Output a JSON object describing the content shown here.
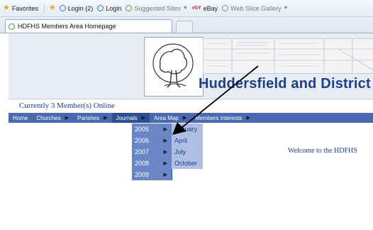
{
  "favorites_bar": {
    "favorites_label": "Favorites",
    "items": [
      {
        "label": "Login (2)",
        "icon": "ie-icon"
      },
      {
        "label": "Login",
        "icon": "ie-icon"
      },
      {
        "label": "Suggested Sites",
        "icon": "suggested-sites-icon"
      },
      {
        "label": "eBay",
        "icon": "ebay-icon"
      },
      {
        "label": "Web Slice Gallery",
        "icon": "ie-icon"
      }
    ]
  },
  "tab": {
    "title": "HDFHS Members Area Homepage"
  },
  "header": {
    "site_title": "Huddersfield and District F"
  },
  "online_status": "Currently 3 Member(s) Online",
  "nav": {
    "items": [
      {
        "label": "Home"
      },
      {
        "label": "Churches"
      },
      {
        "label": "Parishes"
      },
      {
        "label": "Journals"
      },
      {
        "label": "Area Map"
      },
      {
        "label": "Members Interests"
      }
    ]
  },
  "journals_menu": {
    "years": [
      "2005",
      "2006",
      "2007",
      "2008",
      "2009"
    ],
    "months": [
      "January",
      "April",
      "July",
      "October"
    ]
  },
  "welcome": "Welcome to the HDFHS",
  "colors": {
    "nav_bar": "#4a69b0",
    "accent_text": "#1f3f8a",
    "submenu": "#6b86c4",
    "flyout": "#aebfe3"
  }
}
